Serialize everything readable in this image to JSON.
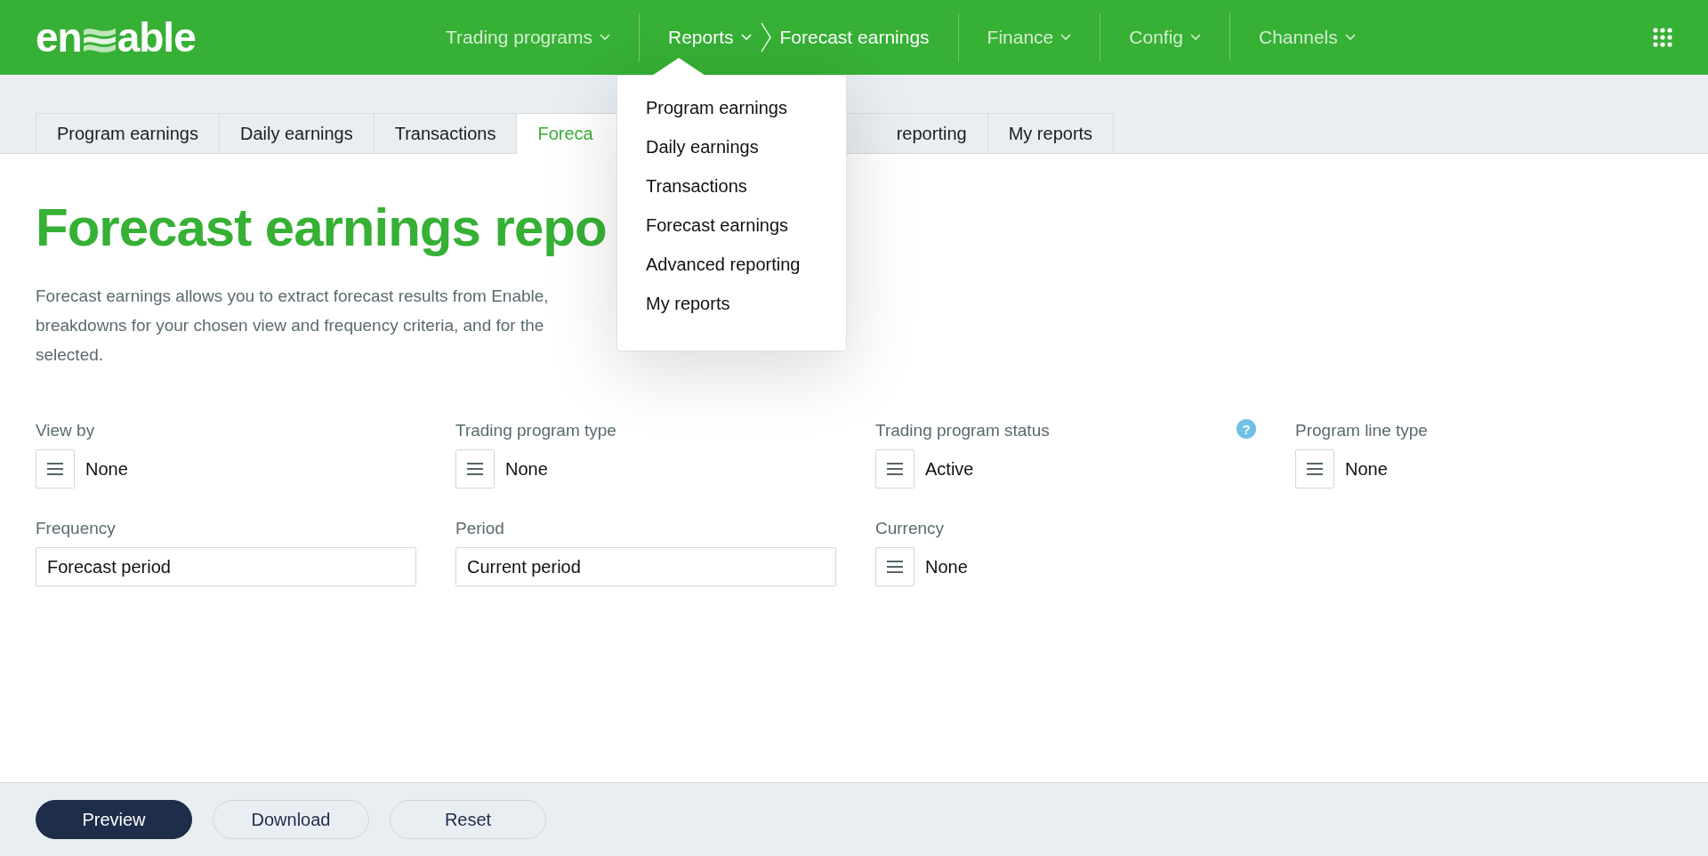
{
  "logo": {
    "start": "en",
    "end": "able"
  },
  "nav": [
    {
      "label": "Trading programs",
      "selected": false
    },
    {
      "label": "Reports",
      "selected": true,
      "crumb": "Forecast earnings"
    },
    {
      "label": "Finance",
      "selected": false
    },
    {
      "label": "Config",
      "selected": false
    },
    {
      "label": "Channels",
      "selected": false
    }
  ],
  "tabs": [
    {
      "label": "Program earnings",
      "selected": false
    },
    {
      "label": "Daily earnings",
      "selected": false
    },
    {
      "label": "Transactions",
      "selected": false
    },
    {
      "label": "Foreca",
      "selected": true
    },
    {
      "label": "reporting",
      "selected": false
    },
    {
      "label": "My reports",
      "selected": false
    }
  ],
  "dropdown": [
    "Program earnings",
    "Daily earnings",
    "Transactions",
    "Forecast earnings",
    "Advanced reporting",
    "My reports"
  ],
  "title": "Forecast earnings repo",
  "description": [
    "Forecast earnings allows you to extract forecast results from Enable,",
    "breakdowns for your chosen view and frequency criteria, and for the",
    "selected."
  ],
  "filters": [
    {
      "label": "View by",
      "kind": "select",
      "value": "None"
    },
    {
      "label": "Trading program type",
      "kind": "select",
      "value": "None"
    },
    {
      "label": "Trading program status",
      "kind": "select",
      "value": "Active",
      "help": "?"
    },
    {
      "label": "Program line type",
      "kind": "select",
      "value": "None"
    },
    {
      "label": "Frequency",
      "kind": "text",
      "value": "Forecast period"
    },
    {
      "label": "Period",
      "kind": "text",
      "value": "Current period"
    },
    {
      "label": "Currency",
      "kind": "select",
      "value": "None"
    }
  ],
  "actions": [
    {
      "label": "Preview",
      "kind": "primary"
    },
    {
      "label": "Download",
      "kind": "secondary"
    },
    {
      "label": "Reset",
      "kind": "secondary"
    }
  ]
}
